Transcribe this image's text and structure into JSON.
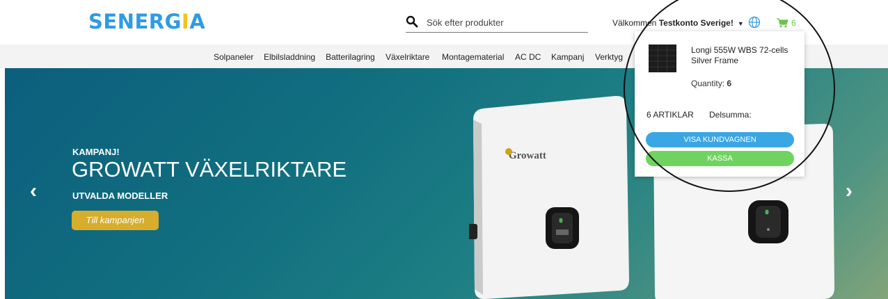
{
  "header": {
    "logo_pre": "SENERG",
    "logo_dot": "I",
    "logo_post": "A",
    "search_placeholder": "Sök efter produkter",
    "welcome_prefix": "Välkommen",
    "welcome_user": "Testkonto Sverige!",
    "cart_count": "6"
  },
  "nav": {
    "items": [
      "Solpaneler",
      "Elbilsladdning",
      "Batterilagring",
      "Växelriktare",
      "Montagematerial",
      "AC DC",
      "Kampanj",
      "Verktyg"
    ]
  },
  "hero": {
    "kicker": "KAMPANJ!",
    "title": "GROWATT VÄXELRIKTARE",
    "subtitle": "UTVALDA MODELLER",
    "button": "Till kampanjen",
    "prev_arrow": "‹",
    "next_arrow": "›",
    "product_brand": "Growatt"
  },
  "cart_popup": {
    "product_name": "Longi 555W WBS 72-cells Silver Frame",
    "quantity_label": "Quantity:",
    "quantity_value": "6",
    "items_count": "6 ARTIKLAR",
    "subtotal_label": "Delsumma:",
    "view_cart": "VISA KUNDVAGNEN",
    "checkout": "KASSA"
  },
  "colors": {
    "brand_blue": "#2f9be4",
    "brand_yellow": "#f4c21a",
    "cart_green": "#6cc34a",
    "view_cart_button": "#3aa6e3",
    "checkout_button": "#6fd45f",
    "promo_button": "#d6ad2c"
  },
  "icons": [
    "search-icon",
    "globe-icon",
    "cart-icon",
    "chevron-down-icon",
    "chevron-left-icon",
    "chevron-right-icon"
  ]
}
